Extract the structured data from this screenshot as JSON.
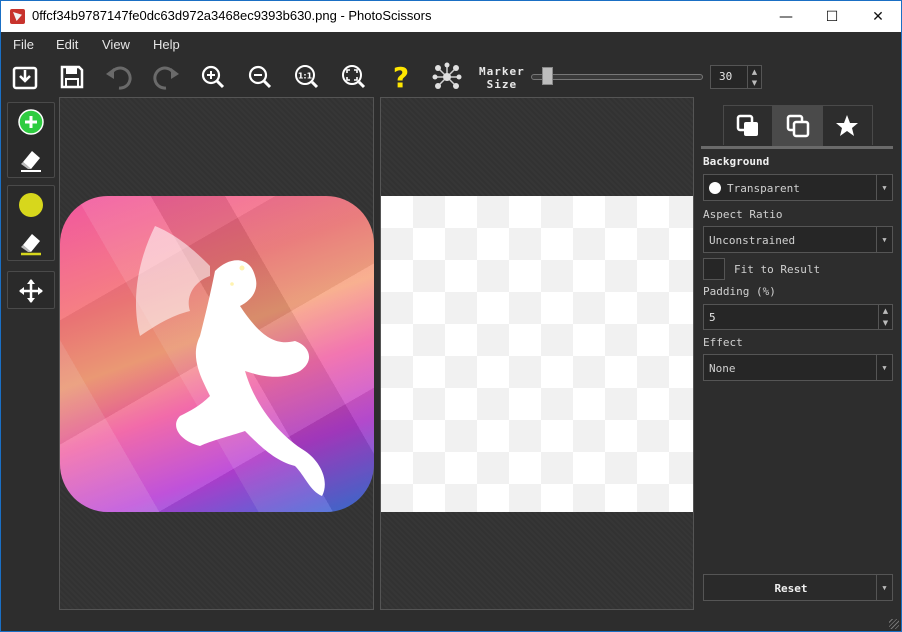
{
  "window": {
    "title": "0ffcf34b9787147fe0dc63d972a3468ec9393b630.png - PhotoScissors",
    "controls": {
      "minimize": "—",
      "maximize": "☐",
      "close": "✕"
    }
  },
  "menu": [
    "File",
    "Edit",
    "View",
    "Help"
  ],
  "toolbar": {
    "marker_label_line1": "Marker",
    "marker_label_line2": "Size",
    "marker_size_value": "30",
    "marker_slider_fraction": 0.07,
    "zoom_actual_label": "1:1",
    "help_glyph": "?"
  },
  "right_panel": {
    "background_label": "Background",
    "background_value": "Transparent",
    "aspect_ratio_label": "Aspect Ratio",
    "aspect_ratio_value": "Unconstrained",
    "fit_to_result_label": "Fit to Result",
    "padding_label": "Padding (%)",
    "padding_value": "5",
    "effect_label": "Effect",
    "effect_value": "None",
    "reset_label": "Reset"
  },
  "colors": {
    "accent_green": "#2ecc40",
    "marker_yellow": "#d7d71c",
    "help_yellow": "#ffe600"
  }
}
